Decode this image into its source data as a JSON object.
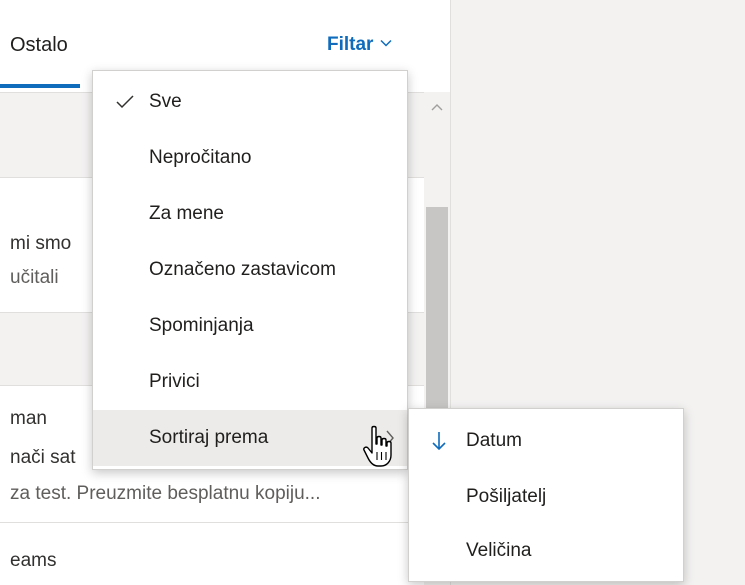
{
  "tabs": {
    "other_label": "Ostalo",
    "filter_label": "Filtar",
    "filter_icon": "chevron-down-icon"
  },
  "mail_list": {
    "lines": [
      "mi smo",
      "učitali",
      "man",
      "nači sat",
      "za test. Preuzmite besplatnu kopiju...",
      "eams"
    ]
  },
  "filter_menu": {
    "items": [
      {
        "label": "Sve",
        "checked": true
      },
      {
        "label": "Nepročitano",
        "checked": false
      },
      {
        "label": "Za mene",
        "checked": false
      },
      {
        "label": "Označeno zastavicom",
        "checked": false
      },
      {
        "label": "Spominjanja",
        "checked": false
      },
      {
        "label": "Privici",
        "checked": false
      },
      {
        "label": "Sortiraj prema",
        "checked": false,
        "has_submenu": true,
        "hovered": true
      }
    ]
  },
  "sort_submenu": {
    "items": [
      {
        "label": "Datum",
        "selected": true,
        "icon": "arrow-down-icon"
      },
      {
        "label": "Pošiljatelj",
        "selected": false
      },
      {
        "label": "Veličina",
        "selected": false
      }
    ]
  },
  "colors": {
    "accent": "#0f6cbd",
    "hover": "#edebe9",
    "group_header": "#f3f2f1",
    "reading_pane": "#f3f2f1",
    "scroll_thumb": "#c8c6c4"
  }
}
